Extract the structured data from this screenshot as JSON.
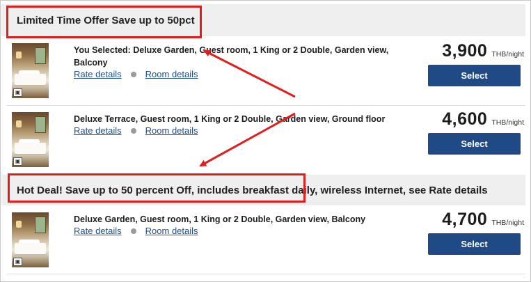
{
  "offers": [
    {
      "header": "Limited Time Offer Save up to 50pct",
      "rooms": [
        {
          "title": "You Selected: Deluxe Garden, Guest room, 1 King or 2 Double, Garden view, Balcony",
          "rate_link": "Rate details",
          "room_link": "Room details",
          "price": "3,900",
          "unit": "THB/night",
          "button": "Select"
        },
        {
          "title": "Deluxe Terrace, Guest room, 1 King or 2 Double, Garden view, Ground floor",
          "rate_link": "Rate details",
          "room_link": "Room details",
          "price": "4,600",
          "unit": "THB/night",
          "button": "Select"
        }
      ]
    },
    {
      "header": "Hot Deal! Save up to 50 percent Off, includes breakfast daily, wireless Internet, see Rate details",
      "rooms": [
        {
          "title": "Deluxe Garden, Guest room, 1 King or 2 Double, Garden view, Balcony",
          "rate_link": "Rate details",
          "room_link": "Room details",
          "price": "4,700",
          "unit": "THB/night",
          "button": "Select"
        }
      ]
    }
  ],
  "colors": {
    "accent_button": "#1f4a85",
    "link": "#1d4f91",
    "annotation": "#e01e1e",
    "header_bg": "#efefef"
  },
  "icons": [
    "camera-icon",
    "separator-dot-icon",
    "annotation-arrow"
  ]
}
